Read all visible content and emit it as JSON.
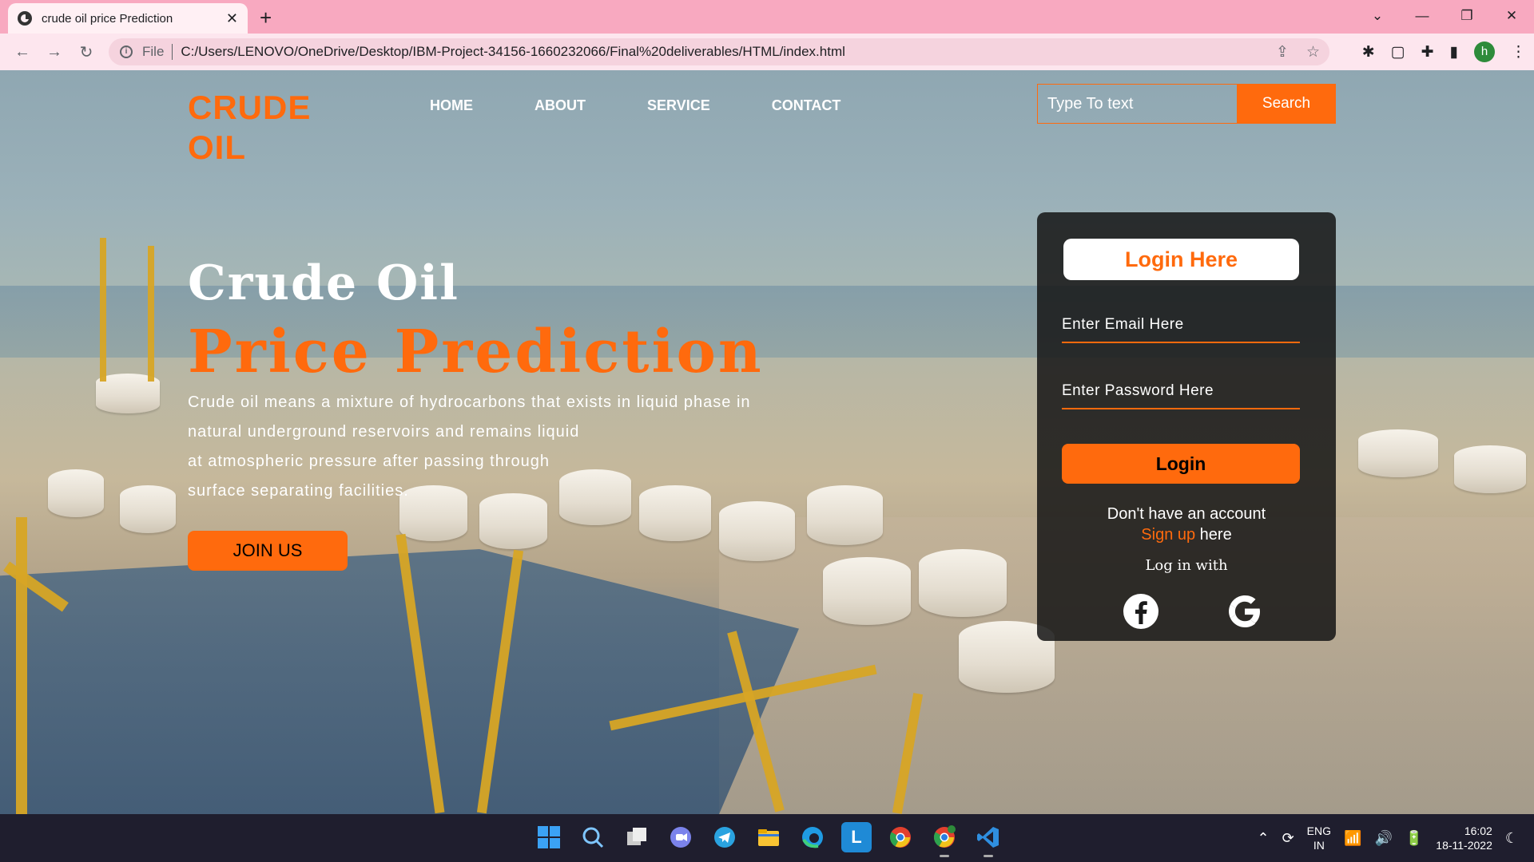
{
  "browser": {
    "tab_title": "crude oil price Prediction",
    "tab_close": "✕",
    "new_tab": "+",
    "scheme_label": "File",
    "url": "C:/Users/LENOVO/OneDrive/Desktop/IBM-Project-34156-1660232066/Final%20deliverables/HTML/index.html",
    "profile_initial": "h",
    "window_controls": [
      "⌄",
      "—",
      "❐",
      "✕"
    ]
  },
  "site": {
    "logo_line1": "CRUDE",
    "logo_line2": "OIL",
    "nav": [
      "HOME",
      "ABOUT",
      "SERVICE",
      "CONTACT"
    ],
    "search_placeholder": "Type To text",
    "search_button": "Search"
  },
  "hero": {
    "title_line1": "Crude Oil",
    "title_line2": "Price Prediction",
    "desc_lines": [
      "Crude oil means a mixture of hydrocarbons that exists in liquid phase in",
      "natural underground reservoirs and remains liquid",
      "at atmospheric pressure after passing through",
      "surface separating facilities."
    ],
    "join_button": "JOIN US"
  },
  "login": {
    "heading": "Login Here",
    "email_placeholder": "Enter Email Here",
    "password_placeholder": "Enter Password Here",
    "login_button": "Login",
    "no_account": "Don't have an account",
    "signup_link": "Sign up",
    "signup_suffix": " here",
    "login_with": "Log in with"
  },
  "taskbar": {
    "lang_line1": "ENG",
    "lang_line2": "IN",
    "time": "16:02",
    "date": "18-11-2022"
  },
  "colors": {
    "accent": "#ff6a0d",
    "tab_bar": "#f8a9c0",
    "taskbar": "#1f1e2e"
  }
}
